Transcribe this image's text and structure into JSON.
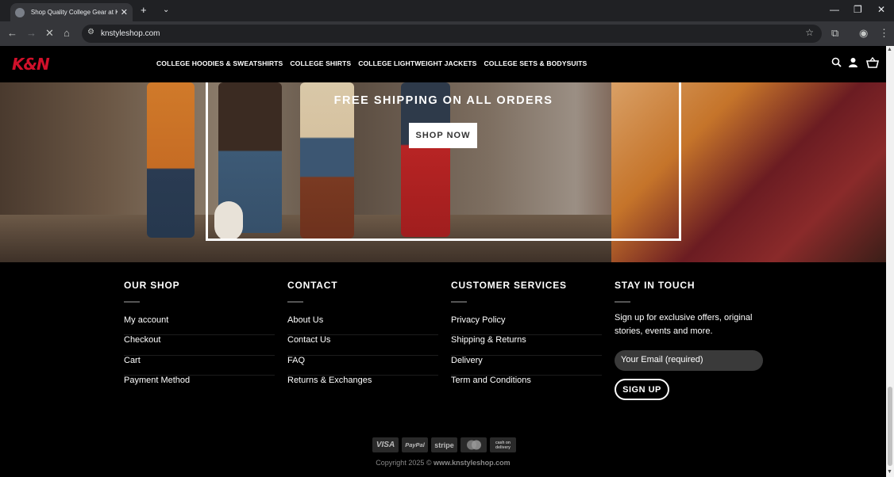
{
  "browser": {
    "tab_title": "Shop Quality College Gear at KN",
    "url": "knstyleshop.com"
  },
  "header": {
    "logo": "K&N",
    "menu": [
      {
        "label": "COLLEGE HOODIES & SWEATSHIRTS"
      },
      {
        "label": "COLLEGE SHIRTS"
      },
      {
        "label": "COLLEGE LIGHTWEIGHT JACKETS"
      },
      {
        "label": "COLLEGE SETS & BODYSUITS"
      }
    ]
  },
  "hero": {
    "promo": "FREE SHIPPING ON ALL ORDERS",
    "button": "SHOP NOW"
  },
  "footer": {
    "our_shop": {
      "title": "OUR SHOP",
      "links": [
        "My account",
        "Checkout",
        "Cart",
        "Payment Method"
      ]
    },
    "contact": {
      "title": "CONTACT",
      "links": [
        "About Us",
        "Contact Us",
        "FAQ",
        "Returns & Exchanges"
      ]
    },
    "customer_services": {
      "title": "CUSTOMER SERVICES",
      "links": [
        "Privacy Policy",
        "Shipping & Returns",
        "Delivery",
        "Term and Conditions"
      ]
    },
    "stay_in_touch": {
      "title": "STAY IN TOUCH",
      "text": "Sign up for exclusive offers, original stories, events and more.",
      "email_placeholder": "Your Email (required)",
      "button": "SIGN UP"
    },
    "payments": [
      "VISA",
      "PayPal",
      "stripe",
      "mastercard",
      "cash on delivery"
    ],
    "copyright_prefix": "Copyright 2025 © ",
    "copyright_site": "www.knstyleshop.com"
  }
}
